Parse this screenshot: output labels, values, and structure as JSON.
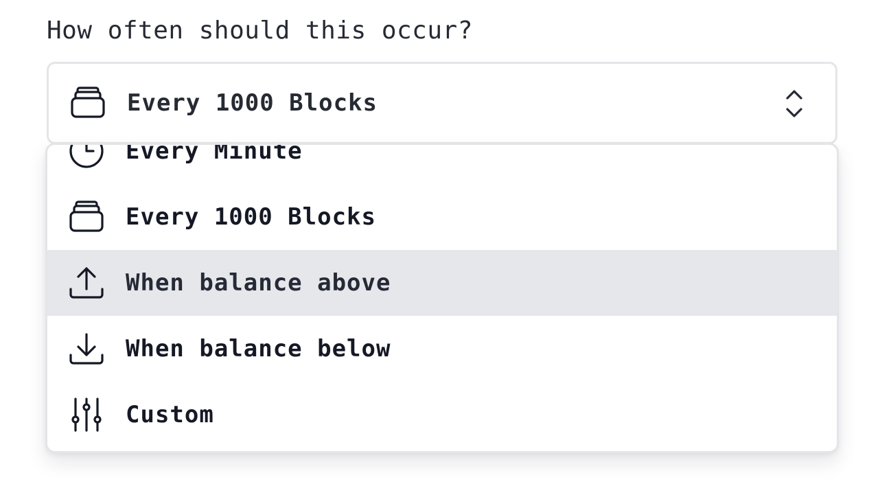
{
  "question": "How often should this occur?",
  "select": {
    "selected_label": "Every 1000 Blocks",
    "selected_icon": "blocks-stack-icon"
  },
  "dropdown": {
    "highlighted_index": 2,
    "options": [
      {
        "label": "Every Minute",
        "icon": "clock-icon"
      },
      {
        "label": "Every 1000 Blocks",
        "icon": "blocks-stack-icon"
      },
      {
        "label": "When balance above",
        "icon": "upload-arrow-icon"
      },
      {
        "label": "When balance below",
        "icon": "download-arrow-icon"
      },
      {
        "label": "Custom",
        "icon": "sliders-icon"
      }
    ]
  },
  "colors": {
    "text": "#151925",
    "border": "#e4e5e8",
    "highlight_bg": "#e6e7eb"
  }
}
